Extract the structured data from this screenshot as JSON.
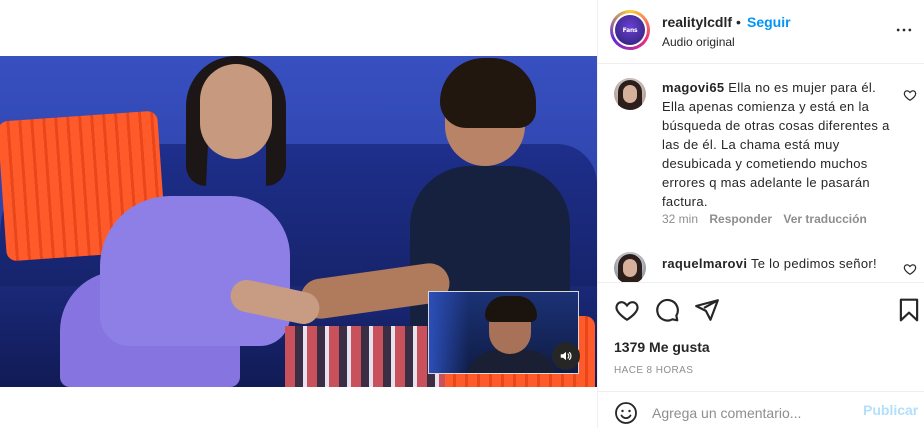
{
  "header": {
    "username": "realitylcdlf",
    "separator": "•",
    "follow_label": "Seguir",
    "audio_label": "Audio original",
    "avatar_text": "Fans"
  },
  "comments": [
    {
      "username": "magovi65",
      "text": "Ella no es mujer para él. Ella apenas comienza y está en la búsqueda de otras cosas diferentes a las de él. La chama está muy desubicada y cometiendo muchos errores q mas adelante le pasarán factura.",
      "time": "32 min",
      "reply_label": "Responder",
      "translate_label": "Ver traducción"
    },
    {
      "username": "raquelmarovi",
      "text": "Te lo pedimos señor!"
    }
  ],
  "post": {
    "likes": "1379 Me gusta",
    "time_ago": "HACE 8 HORAS"
  },
  "composer": {
    "placeholder": "Agrega un comentario...",
    "publish_label": "Publicar"
  },
  "colors": {
    "accent": "#0095f6",
    "publish_disabled": "#b2dffc",
    "muted_text": "#8e8e8e"
  },
  "icons": [
    "more-options-icon",
    "heart-icon",
    "comment-icon",
    "share-icon",
    "save-icon",
    "emoji-icon",
    "speaker-icon"
  ]
}
